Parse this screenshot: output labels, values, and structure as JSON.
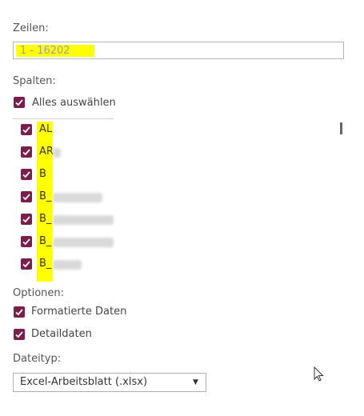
{
  "rows": {
    "label": "Zeilen:",
    "value": "1 - 16202"
  },
  "columns": {
    "label": "Spalten:",
    "select_all": "Alles auswählen",
    "items": [
      {
        "name": "AL",
        "checked": true
      },
      {
        "name": "AR",
        "checked": true
      },
      {
        "name": "B",
        "checked": true
      },
      {
        "name": "B_",
        "checked": true
      },
      {
        "name": "B_",
        "checked": true
      },
      {
        "name": "B_",
        "checked": true
      },
      {
        "name": "B_",
        "checked": true
      }
    ]
  },
  "options": {
    "label": "Optionen:",
    "formatted": "Formatierte Daten",
    "detail": "Detaildaten"
  },
  "filetype": {
    "label": "Dateityp:",
    "selected": "Excel-Arbeitsblatt (.xlsx)"
  },
  "colors": {
    "checkbox": "#7a1f4c",
    "highlight": "#ffff00"
  }
}
